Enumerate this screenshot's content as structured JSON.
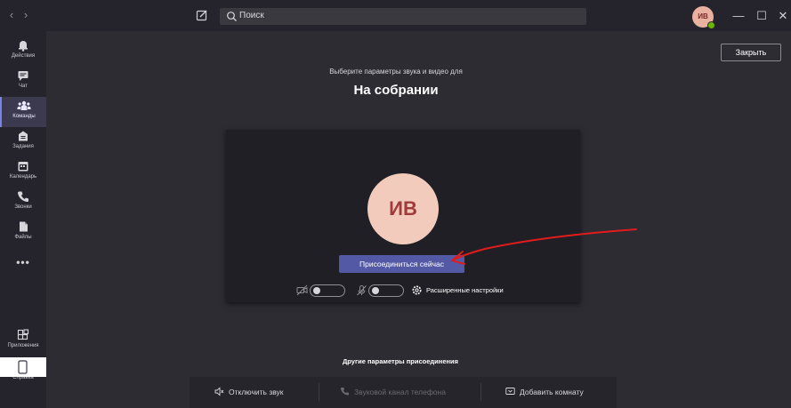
{
  "topbar": {
    "back": "‹",
    "forward": "›",
    "search_placeholder": "Поиск",
    "avatar_initials": "ИВ",
    "minimize": "—",
    "maximize": "☐",
    "close": "✕"
  },
  "rail": {
    "items": [
      {
        "label": "Действия",
        "icon": "bell-icon"
      },
      {
        "label": "Чат",
        "icon": "chat-icon"
      },
      {
        "label": "Команды",
        "icon": "teams-icon",
        "active": true
      },
      {
        "label": "Задания",
        "icon": "assignments-icon"
      },
      {
        "label": "Календарь",
        "icon": "calendar-icon"
      },
      {
        "label": "Звонки",
        "icon": "phone-icon"
      },
      {
        "label": "Файлы",
        "icon": "files-icon"
      }
    ],
    "more": "•••",
    "bottom_items": [
      {
        "label": "Приложения",
        "icon": "apps-icon"
      },
      {
        "label": "Справка",
        "icon": "help-icon"
      }
    ]
  },
  "prejoin": {
    "close_label": "Закрыть",
    "subtitle": "Выберите параметры звука и видео для",
    "title": "На собрании",
    "avatar_initials": "ИВ",
    "join_label": "Присоединиться сейчас",
    "advanced_label": "Расширенные настройки"
  },
  "other": {
    "title": "Другие параметры присоединения",
    "options": [
      {
        "label": "Отключить звук",
        "icon": "speaker-off-icon",
        "enabled": true
      },
      {
        "label": "Звуковой канал телефона",
        "icon": "phone-icon",
        "enabled": false
      },
      {
        "label": "Добавить комнату",
        "icon": "cast-icon",
        "enabled": true
      }
    ]
  },
  "colors": {
    "accent": "#5459a6",
    "annotation": "#e21b1b",
    "background": "#2d2c33",
    "rail": "#25242c"
  }
}
